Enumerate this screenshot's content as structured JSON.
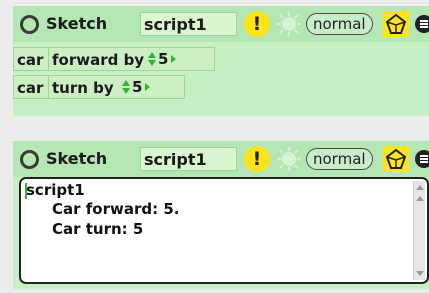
{
  "panel1": {
    "header": {
      "title": "Sketch",
      "script_name": "script1",
      "alert": "!",
      "mode": "normal"
    },
    "tiles": [
      {
        "object": "car",
        "command": "forward by",
        "value": "5"
      },
      {
        "object": "car",
        "command": "turn by",
        "value": "5"
      }
    ]
  },
  "panel2": {
    "header": {
      "title": "Sketch",
      "script_name": "script1",
      "alert": "!",
      "mode": "normal"
    },
    "code": [
      "script1",
      "Car forward: 5.",
      "Car turn: 5"
    ]
  },
  "colors": {
    "panel_bg": "#c6efc6",
    "header_bg": "#b4e7b4",
    "alert_yellow": "#ffe419",
    "accent_green": "#2fb82f"
  },
  "icons": [
    "ring-icon",
    "alert-icon",
    "clock-icon",
    "gem-icon",
    "menu-icon",
    "up-down-arrows-icon",
    "right-arrow-icon"
  ]
}
